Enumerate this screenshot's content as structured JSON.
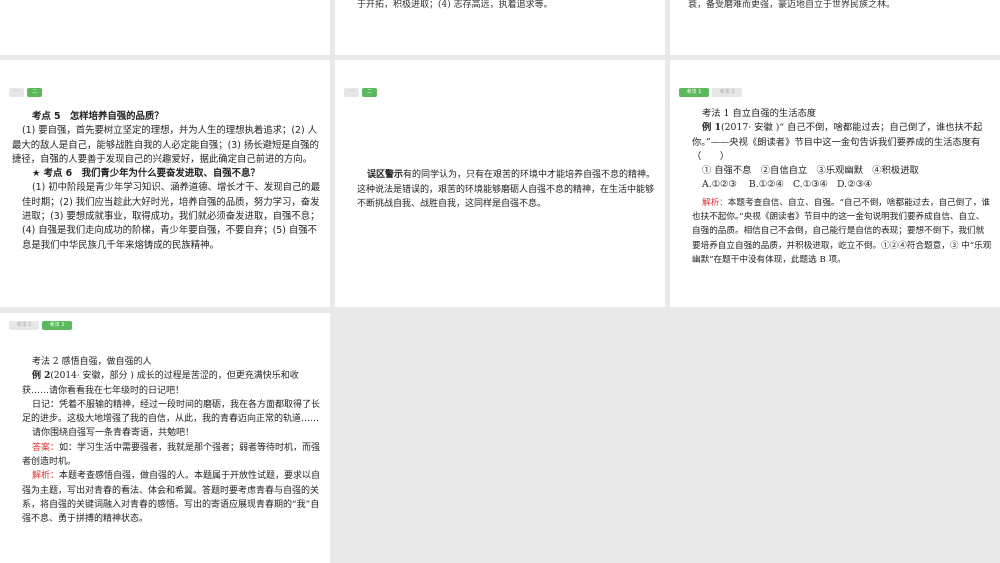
{
  "row1": {
    "slide2_fragment": "于开拓，积极进取；(4) 志存高远，执着追求等。",
    "slide3_fragment": "衰，备受磨难而更强，豪迈地自立于世界民族之林。"
  },
  "tabs_numeric": [
    "一",
    "二"
  ],
  "tabs_kaofa": [
    "考法 1",
    "考法 2"
  ],
  "slide4": {
    "h1": "考点 5　怎样培养自强的品质？",
    "p1": "(1) 要自强，首先要树立坚定的理想，并为人生的理想执着追求；(2) 人最大的敌人是自己，能够战胜自我的人必定能自强；(3) 扬长避短是自强的捷径，自强的人要善于发现自己的兴趣爱好，据此确定自己前进的方向。",
    "h2": "★ 考点 6　我们青少年为什么要奋发进取、自强不息？",
    "p2": "(1) 初中阶段是青少年学习知识、涵养道德、增长才干、发现自己的最佳时期；(2) 我们应当趁此大好时光，培养自强的品质，努力学习，奋发进取；(3) 要想成就事业，取得成功，我们就必须奋发进取，自强不息；(4) 自强是我们走向成功的阶梯，青少年要自强，不要自弃；(5) 自强不息是我们中华民族几千年来熔铸成的民族精神。"
  },
  "slide5": {
    "label": "误区警示",
    "text": "有的同学认为，只有在艰苦的环境中才能培养自强不息的精神。这种说法是错误的，艰苦的环境能够磨砺人自强不息的精神，在生活中能够不断挑战自我、战胜自我，这同样是自强不息。"
  },
  "slide6": {
    "title": "考法 1 自立自强的生活态度",
    "ex_label": "例 1",
    "question": "(2017· 安徽 )“ 自己不倒，啥都能过去；自己倒了，谁也扶不起你。”——央视《朗读者》节目中这一金句告诉我们要养成的生活态度有（　　）",
    "options_line": "① 自强不息　②自信自立　③乐观幽默　④积极进取",
    "choices": "A.①②③　 B.①②④　C.①③④　D.②③④",
    "analysis_label": "解析：",
    "analysis": "本题考查自信、自立、自强。“自己不倒，啥都能过去，自己倒了，谁也扶不起你。”央视《朗读者》节目中的这一金句说明我们要养成自信、自立、自强的品质。相信自己不会倒，自己能行是自信的表现；要想不倒下，我们就要培养自立自强的品质，并积极进取，屹立不倒。①②④符合题意，③ 中“乐观幽默”在题干中没有体现，此题选 B 项。"
  },
  "slide7": {
    "title": "考法 2 感悟自强，做自强的人",
    "ex_label": "例 2",
    "question": "(2014· 安徽，部分 ) 成长的过程是苦涩的，但更充满快乐和收获……请你看看我在七年级时的日记吧！",
    "diary": "日记：凭着不服输的精神，经过一段时间的磨砺，我在各方面都取得了长足的进步。这极大地增强了我的自信，从此，我的青春迈向正常的轨道……",
    "prompt": "请你围绕自强写一条青春寄语，共勉吧！",
    "answer_label": "答案：",
    "answer": "如：学习生活中需要强者，我就是那个强者；弱者等待时机，而强者创造时机。",
    "analysis_label": "解析：",
    "analysis": "本题考查感悟自强，做自强的人。本题属于开放性试题，要求以自强为主题，写出对青春的看法、体会和希翼。答题时要考虑青春与自强的关系，将自强的关键词融入对青春的感悟。写出的寄语应展现青春期的“我”自强不息、勇于拼搏的精神状态。"
  }
}
